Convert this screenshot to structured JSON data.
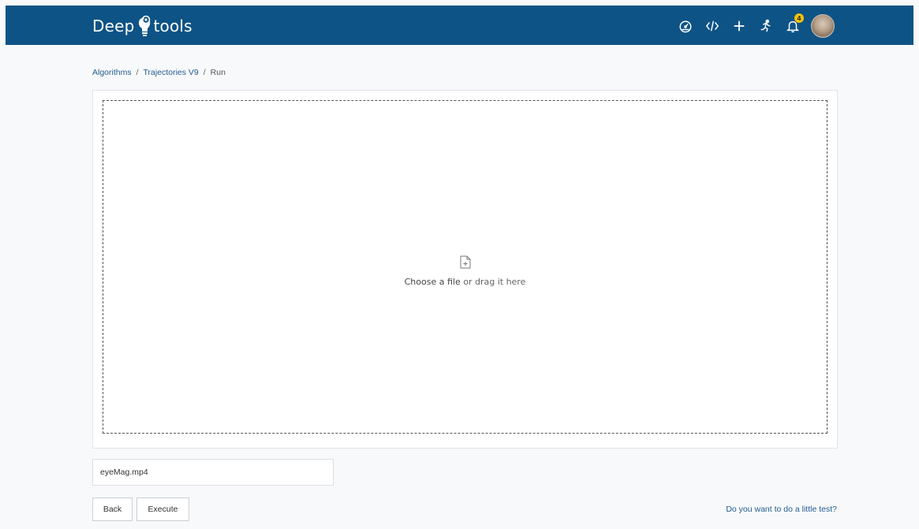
{
  "app": {
    "logo_left": "Deep",
    "logo_right": "tools",
    "brand_color": "#0e5386",
    "accent_color": "#f5c400"
  },
  "topbar": {
    "icons": [
      "dashboard-icon",
      "code-icon",
      "plus-icon",
      "runner-icon",
      "bell-icon",
      "avatar"
    ],
    "notification_count": "4"
  },
  "breadcrumb": {
    "items": [
      "Algorithms",
      "Trajectories V9",
      "Run"
    ],
    "separator": "/"
  },
  "dropzone": {
    "choose_label": "Choose a file",
    "drag_label": " or drag it here"
  },
  "file_input": {
    "value": "eyeMag.mp4"
  },
  "actions": {
    "back_label": "Back",
    "execute_label": "Execute",
    "test_link": "Do you want to do a little test?"
  }
}
